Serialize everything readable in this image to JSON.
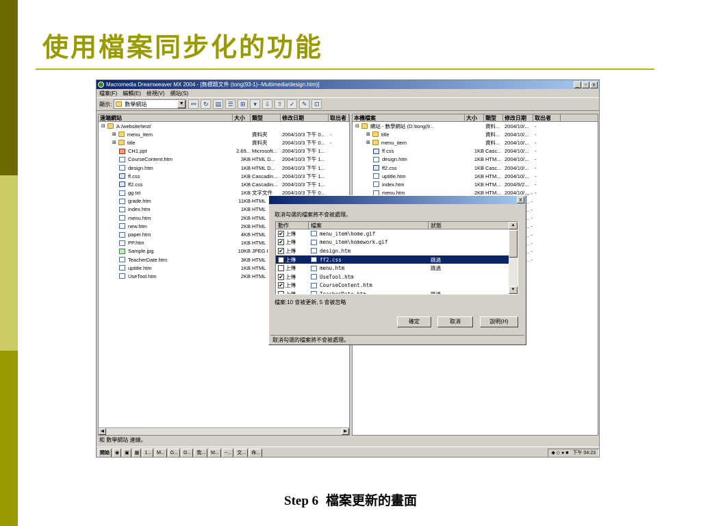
{
  "slide": {
    "title": "使用檔案同步化的功能",
    "caption_step": "Step 6",
    "caption_text": "檔案更新的畫面"
  },
  "window": {
    "title": "Macromedia Dreamweaver MX 2004 - [無標題文件 (tong(93-1)--Multimedia/design.htm)]",
    "buttons": [
      "_",
      "▫",
      "x"
    ],
    "menu": [
      "檔案(F)",
      "編輯(E)",
      "檢視(V)",
      "網站(S)"
    ]
  },
  "toolbar": {
    "show_label": "顯示:",
    "site": "數學網站"
  },
  "remote": {
    "columns": [
      "遠端網站",
      "大小",
      "類型",
      "修改日期",
      "取出者"
    ],
    "root": "A:/website/test/",
    "rows": [
      {
        "name": "menu_item",
        "size": "",
        "type": "資料夾",
        "date": "2004/10/3 下午 0...",
        "out": "-",
        "icon": "folder"
      },
      {
        "name": "title",
        "size": "",
        "type": "資料夾",
        "date": "2004/10/3 下午 0...",
        "out": "-",
        "icon": "folder"
      },
      {
        "name": "CH1.ppt",
        "size": "2.69...",
        "type": "Microsoft...",
        "date": "2004/10/3 下午 1...",
        "out": "",
        "icon": "ppt"
      },
      {
        "name": "CourseContent.htm",
        "size": "3KB",
        "type": "HTML D...",
        "date": "2004/10/3 下午 1...",
        "out": "",
        "icon": "file"
      },
      {
        "name": "design.htm",
        "size": "1KB",
        "type": "HTML D...",
        "date": "2004/10/3 下午 1...",
        "out": "",
        "icon": "file"
      },
      {
        "name": "ff.css",
        "size": "1KB",
        "type": "Cascadin...",
        "date": "2004/10/3 下午 1...",
        "out": "",
        "icon": "css"
      },
      {
        "name": "ff2.css",
        "size": "1KB",
        "type": "Cascadin...",
        "date": "2004/10/3 下午 1...",
        "out": "",
        "icon": "css"
      },
      {
        "name": "gg.txt",
        "size": "1KB",
        "type": "文字文件",
        "date": "2004/10/3 下午 0...",
        "out": "",
        "icon": "file"
      },
      {
        "name": "grade.htm",
        "size": "11KB",
        "type": "HTML",
        "date": "",
        "out": "",
        "icon": "file"
      },
      {
        "name": "index.htm",
        "size": "1KB",
        "type": "HTML",
        "date": "",
        "out": "",
        "icon": "file"
      },
      {
        "name": "menu.htm",
        "size": "2KB",
        "type": "HTML",
        "date": "",
        "out": "",
        "icon": "file"
      },
      {
        "name": "new.htm",
        "size": "2KB",
        "type": "HTML",
        "date": "",
        "out": "",
        "icon": "file"
      },
      {
        "name": "paper.htm",
        "size": "4KB",
        "type": "HTML",
        "date": "",
        "out": "",
        "icon": "file"
      },
      {
        "name": "PP.htm",
        "size": "1KB",
        "type": "HTML",
        "date": "",
        "out": "",
        "icon": "file"
      },
      {
        "name": "Sample.jpg",
        "size": "10KB",
        "type": "JPEG I",
        "date": "",
        "out": "",
        "icon": "img"
      },
      {
        "name": "TeacherDate.htm",
        "size": "3KB",
        "type": "HTML",
        "date": "",
        "out": "",
        "icon": "file"
      },
      {
        "name": "uptitle.htm",
        "size": "1KB",
        "type": "HTML",
        "date": "",
        "out": "",
        "icon": "file"
      },
      {
        "name": "UseTool.htm",
        "size": "2KB",
        "type": "HTML",
        "date": "",
        "out": "",
        "icon": "file"
      }
    ]
  },
  "local": {
    "columns": [
      "本機檔案",
      "大小",
      "類型",
      "修改日期",
      "取出者"
    ],
    "root": "網站 - 數學網站 (D:\\tong(9...",
    "root_type": "資料...",
    "root_date": "2004/10/...",
    "root_out": "-",
    "rows": [
      {
        "name": "title",
        "size": "",
        "type": "資料...",
        "date": "2004/10/...",
        "out": "-",
        "icon": "folder"
      },
      {
        "name": "menu_item",
        "size": "",
        "type": "資料...",
        "date": "2004/10/...",
        "out": "-",
        "icon": "folder"
      },
      {
        "name": "ff.css",
        "size": "1KB",
        "type": "Casc...",
        "date": "2004/10/...",
        "out": "-",
        "icon": "css"
      },
      {
        "name": "design.htm",
        "size": "1KB",
        "type": "HTM...",
        "date": "2004/10/...",
        "out": "-",
        "icon": "file"
      },
      {
        "name": "ff2.css",
        "size": "1KB",
        "type": "Casc...",
        "date": "2004/10/...",
        "out": "-",
        "icon": "css"
      },
      {
        "name": "uptitle.htm",
        "size": "1KB",
        "type": "HTM...",
        "date": "2004/10/...",
        "out": "-",
        "icon": "file"
      },
      {
        "name": "index.htm",
        "size": "1KB",
        "type": "HTM...",
        "date": "2004/9/2...",
        "out": "-",
        "icon": "file"
      },
      {
        "name": "menu.htm",
        "size": "2KB",
        "type": "HTM...",
        "date": "2004/10/...",
        "out": "-",
        "icon": "file"
      }
    ],
    "partial_rows": [
      "..  -",
      "..  -",
      "..  -",
      "..  -",
      "..  -",
      "..  -",
      "..  -",
      "..  -",
      "..  -"
    ]
  },
  "status": "和 數學網站 連線。",
  "taskbar": {
    "start": "開始",
    "tasks": [
      "1...",
      "M...",
      "G...",
      "G...",
      "我...",
      "M...",
      "--...",
      "文...",
      "命..."
    ],
    "clock": "下午 04:23"
  },
  "dialog": {
    "message": "取消勾選的檔案將不會被處理。",
    "columns": [
      "動作",
      "檔案",
      "狀態"
    ],
    "rows": [
      {
        "checked": true,
        "action": "上傳",
        "file": "menu_item\\home.gif",
        "status": "",
        "selected": false
      },
      {
        "checked": true,
        "action": "上傳",
        "file": "menu_item\\homework.gif",
        "status": "",
        "selected": false
      },
      {
        "checked": true,
        "action": "上傳",
        "file": "design.htm",
        "status": "",
        "selected": false
      },
      {
        "checked": false,
        "action": "上傳",
        "file": "ff2.css",
        "status": "跳過",
        "selected": true
      },
      {
        "checked": false,
        "action": "上傳",
        "file": "menu.htm",
        "status": "跳過",
        "selected": false
      },
      {
        "checked": true,
        "action": "上傳",
        "file": "UseTool.htm",
        "status": "",
        "selected": false
      },
      {
        "checked": true,
        "action": "上傳",
        "file": "CourseContent.htm",
        "status": "",
        "selected": false
      },
      {
        "checked": false,
        "action": "上傳",
        "file": "TeacherDate.htm",
        "status": "跳過",
        "selected": false
      }
    ],
    "summary": "檔案:10 會被更新, 5 會被忽略",
    "ok": "確定",
    "cancel": "取消",
    "help": "說明(H)",
    "footer": "取消勾選的檔案將不會被處理。"
  }
}
